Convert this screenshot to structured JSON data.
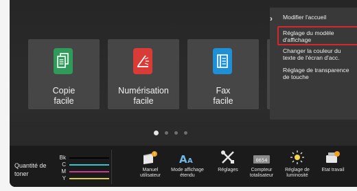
{
  "tiles": [
    {
      "label": "Copie\nfacile",
      "icon": "copy-icon",
      "color": "#2f9a5a"
    },
    {
      "label": "Numérisation\nfacile",
      "icon": "scan-icon",
      "color": "#d93b36"
    },
    {
      "label": "Fax\nfacile",
      "icon": "fax-icon",
      "color": "#1f8fd6"
    }
  ],
  "pager": {
    "pages": 4,
    "active": 1
  },
  "toner": {
    "label": "Quantité de\ntoner",
    "colors": [
      {
        "name": "Bk",
        "color": "#000000",
        "level": 0.95
      },
      {
        "name": "C",
        "color": "#2fc6cf",
        "level": 0.95
      },
      {
        "name": "M",
        "color": "#c43e92",
        "level": 0.95
      },
      {
        "name": "Y",
        "color": "#d9cf3a",
        "level": 0.95
      }
    ]
  },
  "bottom_items": [
    {
      "label": "Manuel\nutilisateur",
      "icon": "manual-icon"
    },
    {
      "label": "Mode affichage\nétendu",
      "icon": "enlarged-text-icon"
    },
    {
      "label": "Réglages",
      "icon": "settings-icon"
    },
    {
      "label": "Compteur\ntotalisateur",
      "icon": "counter-icon"
    },
    {
      "label": "Réglage de\nluminosité",
      "icon": "brightness-icon"
    },
    {
      "label": "Etat travail",
      "icon": "job-status-icon"
    }
  ],
  "panel": {
    "items": [
      "Modifier l'accueil",
      "Réglage du modèle\nd'affichage",
      "Changer la couleur du\ntexte de l'écran d'acc.",
      "Réglage de transparence\nde touche"
    ],
    "selected_index": 1,
    "highlight_color": "#d8262e"
  }
}
